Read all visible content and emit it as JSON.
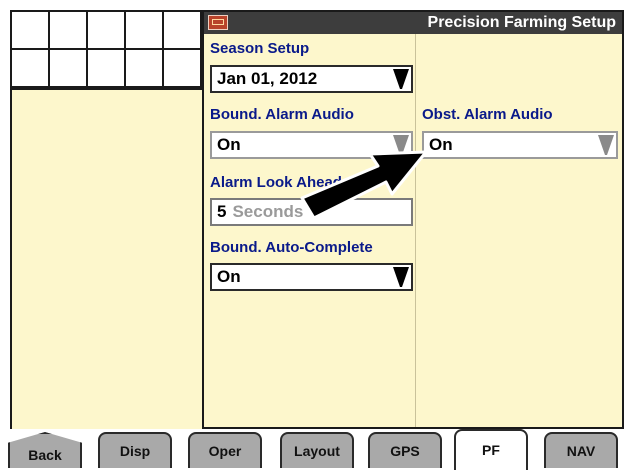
{
  "header": {
    "title": "Precision Farming Setup",
    "icon": "display-icon"
  },
  "fields": {
    "season_setup": {
      "label": "Season Setup",
      "value": "Jan 01, 2012"
    },
    "bound_alarm_audio": {
      "label": "Bound. Alarm Audio",
      "value": "On"
    },
    "obst_alarm_audio": {
      "label": "Obst. Alarm Audio",
      "value": "On"
    },
    "alarm_look_ahead": {
      "label": "Alarm Look Ahead",
      "value": "5",
      "unit": "Seconds"
    },
    "bound_auto_complete": {
      "label": "Bound. Auto-Complete",
      "value": "On"
    }
  },
  "tabs": [
    {
      "label": "Back"
    },
    {
      "label": "Disp"
    },
    {
      "label": "Oper"
    },
    {
      "label": "Layout"
    },
    {
      "label": "GPS"
    },
    {
      "label": "PF",
      "active": true
    },
    {
      "label": "NAV"
    }
  ],
  "colors": {
    "panel": "#fdf7cc",
    "label": "#0a1a8a",
    "titlebar": "#3d3d3d",
    "tab": "#a9a9a9"
  }
}
